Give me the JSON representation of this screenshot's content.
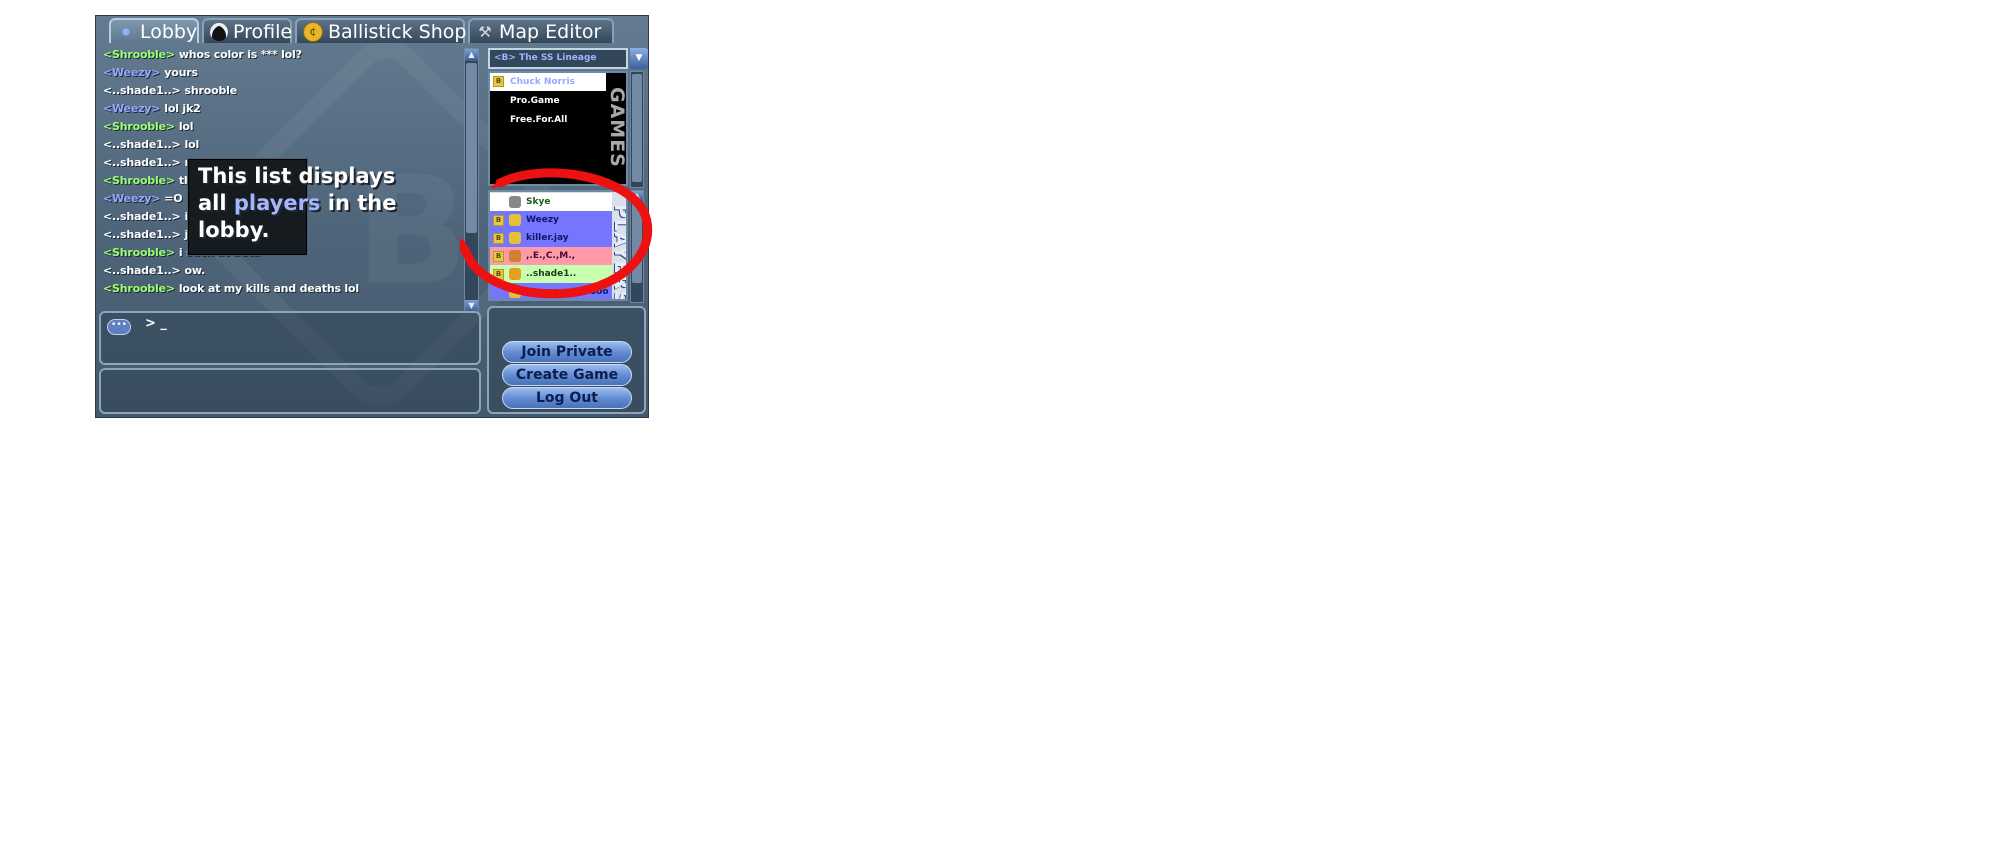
{
  "tabs": [
    {
      "label": "Lobby",
      "icon": "lobby-icon",
      "active": true
    },
    {
      "label": "Profile",
      "icon": "alien-head-icon",
      "active": false
    },
    {
      "label": "Ballistick Shop",
      "icon": "coin-icon",
      "active": false
    },
    {
      "label": "Map Editor",
      "icon": "hammer-wrench-icon",
      "active": false
    }
  ],
  "chat": {
    "messages": [
      {
        "nick": "<Shrooble>",
        "color": "green",
        "text": "whos color is *** lol?"
      },
      {
        "nick": "<Weezy>",
        "color": "blue",
        "text": "yours"
      },
      {
        "nick": "<..shade1..>",
        "color": "white",
        "text": "shrooble"
      },
      {
        "nick": "<Weezy>",
        "color": "blue",
        "text": "lol jk2"
      },
      {
        "nick": "<Shrooble>",
        "color": "green",
        "text": "lol"
      },
      {
        "nick": "<..shade1..>",
        "color": "white",
        "text": "lol"
      },
      {
        "nick": "<..shade1..>",
        "color": "white",
        "text": "nic"
      },
      {
        "nick": "<Shrooble>",
        "color": "green",
        "text": "th"
      },
      {
        "nick": "<Weezy>",
        "color": "blue",
        "text": "=O"
      },
      {
        "nick": "<..shade1..>",
        "color": "white",
        "text": "i w"
      },
      {
        "nick": "<..shade1..>",
        "color": "white",
        "text": "jk"
      },
      {
        "nick": "<Shrooble>",
        "color": "green",
        "text": "i suck at beta"
      },
      {
        "nick": "<..shade1..>",
        "color": "white",
        "text": "ow."
      },
      {
        "nick": "<Shrooble>",
        "color": "green",
        "text": "look at my kills and deaths lol"
      }
    ],
    "input_prompt": "> _"
  },
  "tooltip": {
    "part1": "This list displays all",
    "highlight": "players",
    "part2": "in the lobby."
  },
  "server": {
    "selected": "<B> The SS Lineage"
  },
  "games": {
    "label": "GAMES",
    "items": [
      {
        "name": "Chuck Norris",
        "locked": true,
        "selected": true
      },
      {
        "name": "Pro.Game",
        "locked": false,
        "selected": false
      },
      {
        "name": "Free.For.All",
        "locked": false,
        "selected": false
      }
    ]
  },
  "players": {
    "label": "PLAYERS",
    "items": [
      {
        "name": "Skye",
        "bg": "#ffffff",
        "fg": "#1a5a1a",
        "icon": "#888888",
        "locked": false
      },
      {
        "name": "Weezy",
        "bg": "#7575ff",
        "fg": "#0c1a66",
        "icon": "#e3c23a",
        "locked": true
      },
      {
        "name": "killer.jay",
        "bg": "#7575ff",
        "fg": "#0c1a66",
        "icon": "#e3c23a",
        "locked": true
      },
      {
        "name": ",.E.,C.,M.,",
        "bg": "#ff9aa8",
        "fg": "#4a0a3a",
        "icon": "#d08030",
        "locked": true
      },
      {
        "name": "..shade1..",
        "bg": "#c7ffaf",
        "fg": "#1a3a1a",
        "icon": "#e3a020",
        "locked": true
      },
      {
        "name": "woooooooooooo",
        "bg": "#7575ff",
        "fg": "#0c1a66",
        "icon": "#e3c23a",
        "locked": false
      }
    ]
  },
  "buttons": {
    "join_private": "Join Private",
    "create_game": "Create Game",
    "log_out": "Log Out"
  },
  "colors": {
    "nick_green": "#9cff72",
    "nick_blue": "#96a7ff",
    "annotation_circle": "#ee1111",
    "button_text": "#0b1e4d"
  }
}
